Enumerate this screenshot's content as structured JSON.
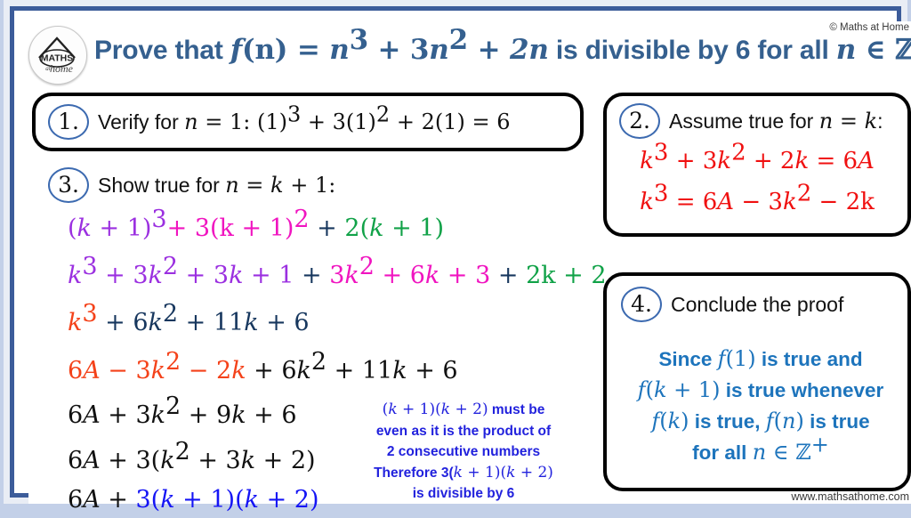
{
  "branding": {
    "logo_line1": "MATHS",
    "logo_line2": "at",
    "logo_line3": "home",
    "copyright": "© Maths at Home",
    "website": "www.mathsathome.com"
  },
  "header": {
    "title_plain": "Prove that f(n) = n³ + 3n² + 2n is divisible by 6 for all n ∈ ℤ⁺",
    "title_prefix": "Prove that ",
    "title_fn": "f",
    "title_fn_arg": "(n)",
    "title_equals": " = ",
    "title_term1_base": "n",
    "title_term1_exp": "3",
    "title_plus1": " + ",
    "title_term2_coef": "3",
    "title_term2_base": "n",
    "title_term2_exp": "2",
    "title_plus2": " + ",
    "title_term3": "2n",
    "title_middle": " is divisible by 6 for all ",
    "title_var": "n",
    "title_in": " ∈ ",
    "title_set": "ℤ",
    "title_set_exp": "+"
  },
  "steps": {
    "step1": {
      "number": "1.",
      "heading": "Verify for ",
      "var": "n",
      "equals": " = 1:",
      "expression_gap": "  ",
      "e_a_open": "(1)",
      "e_a_exp": "3",
      "e_plus1": " + ",
      "e_b_coef": "3(1)",
      "e_b_exp": "2",
      "e_plus2": " + ",
      "e_c": "2(1) = 6"
    },
    "step2": {
      "number": "2.",
      "heading": "Assume true for ",
      "var": "n",
      "equals": " = ",
      "var2": "k",
      "colon": ":",
      "eq1_a_base": "k",
      "eq1_a_exp": "3",
      "eq1_plus1": " + 3",
      "eq1_b_base": "k",
      "eq1_b_exp": "2",
      "eq1_plus2": " + 2",
      "eq1_c": "k",
      "eq1_eq": " = 6",
      "eq1_A": "A",
      "eq2_a_base": "k",
      "eq2_a_exp": "3",
      "eq2_eq": " = 6",
      "eq2_A": "A",
      "eq2_minus1": " − 3",
      "eq2_b_base": "k",
      "eq2_b_exp": "2",
      "eq2_minus2": " − 2k"
    },
    "step3": {
      "number": "3.",
      "heading": "Show true for ",
      "var": "n",
      "equals": " = ",
      "var2": "k",
      "plus_one": " + 1:",
      "lines": {
        "line1": {
          "p1_open": "(",
          "p1_k": "k",
          "p1_plus": " + 1)",
          "p1_exp": "3",
          "p2_plus": "+ ",
          "p2_body": "3(k + 1)",
          "p2_exp": "2",
          "p3_plus": " + ",
          "p3_coef": "2(",
          "p3_k": "k",
          "p3_close": " + 1)"
        },
        "line2": {
          "a_base": "k",
          "a_exp": "3",
          "a_rest_1": " + 3",
          "a_k2_base": "k",
          "a_k2_exp": "2",
          "a_rest_2": " + 3",
          "a_k": "k",
          "a_rest_3": " + 1",
          "plus_mid": " + ",
          "b_coef": "3",
          "b_base": "k",
          "b_exp": "2",
          "b_plus": " + 6",
          "b_k": "k",
          "b_plus2": " + 3",
          "plus_mid2": " + ",
          "c": "2k + 2"
        },
        "line3": {
          "a_base": "k",
          "a_exp": "3",
          "rest_1": " + 6",
          "k2_base": "k",
          "k2_exp": "2",
          "rest_2": " + 11",
          "k_var": "k",
          "rest_3": " + 6"
        },
        "line4": {
          "sub_6A": "6",
          "sub_A": "A",
          "sub_minus1": " − 3",
          "sub_k2_base": "k",
          "sub_k2_exp": "2",
          "sub_minus2": " − 2",
          "sub_k": "k",
          "tail_plus1": " + 6",
          "tail_k2_base": "k",
          "tail_k2_exp": "2",
          "tail_plus2": " + 11",
          "tail_k": "k",
          "tail_plus3": " + 6"
        },
        "line5": {
          "a": "6",
          "a_A": "A",
          "plus1": " + 3",
          "k2_base": "k",
          "k2_exp": "2",
          "plus2": " + 9",
          "k_var": "k",
          "plus3": " + 6"
        },
        "line6": {
          "a": "6",
          "a_A": "A",
          "plus1": " + 3(",
          "k2_base": "k",
          "k2_exp": "2",
          "plus2": " + 3",
          "k_var": "k",
          "plus3": " + 2)"
        },
        "line7": {
          "a": "6",
          "a_A": "A",
          "plus": " + ",
          "factored_open": "3(",
          "f_k1": "k",
          "f_mid": " + 1)(",
          "f_k2": "k",
          "f_close": " + 2)"
        }
      }
    },
    "step4": {
      "number": "4.",
      "heading": "Conclude the proof",
      "c_since": "Since ",
      "c_f1": "f",
      "c_f1_arg": "(1)",
      "c_true_and": " is true and",
      "c_fk1": "f",
      "c_fk1_open": "(",
      "c_fk1_k": "k",
      "c_fk1_close": " + 1)",
      "c_true_whenever": " is true whenever",
      "c_fk": "f",
      "c_fk_open": "(",
      "c_fk_k": "k",
      "c_fk_close": ")",
      "c_is_true_comma": " is true, ",
      "c_fn": "f",
      "c_fn_open": "(",
      "c_fn_n": "n",
      "c_fn_close": ")",
      "c_is_true": " is true",
      "c_forall": "for all ",
      "c_n": "n",
      "c_in": " ∈ ",
      "c_set": "ℤ",
      "c_set_exp": "+"
    }
  },
  "annotation": {
    "l1_open": "(",
    "l1_k1": "k",
    "l1_mid": " + 1)(",
    "l1_k2": "k",
    "l1_close": " + 2)",
    "l1_tail": " must be",
    "l2": "even as it is the product of",
    "l3": "2 consecutive numbers",
    "l4_prefix": "Therefore 3(",
    "l4_k1": "k",
    "l4_mid": " + 1)(",
    "l4_k2": "k",
    "l4_close": " + 2)",
    "l5": "is divisible by 6"
  },
  "colors": {
    "frame_blue": "#3c5c9a",
    "title_blue": "#35608f",
    "red": "#f01010",
    "purple": "#9b30e0",
    "magenta": "#f015c0",
    "green": "#11a248",
    "navy": "#17375e",
    "orange": "#f4421a",
    "blue": "#1515f5",
    "conclusion_blue": "#1d74bc"
  }
}
